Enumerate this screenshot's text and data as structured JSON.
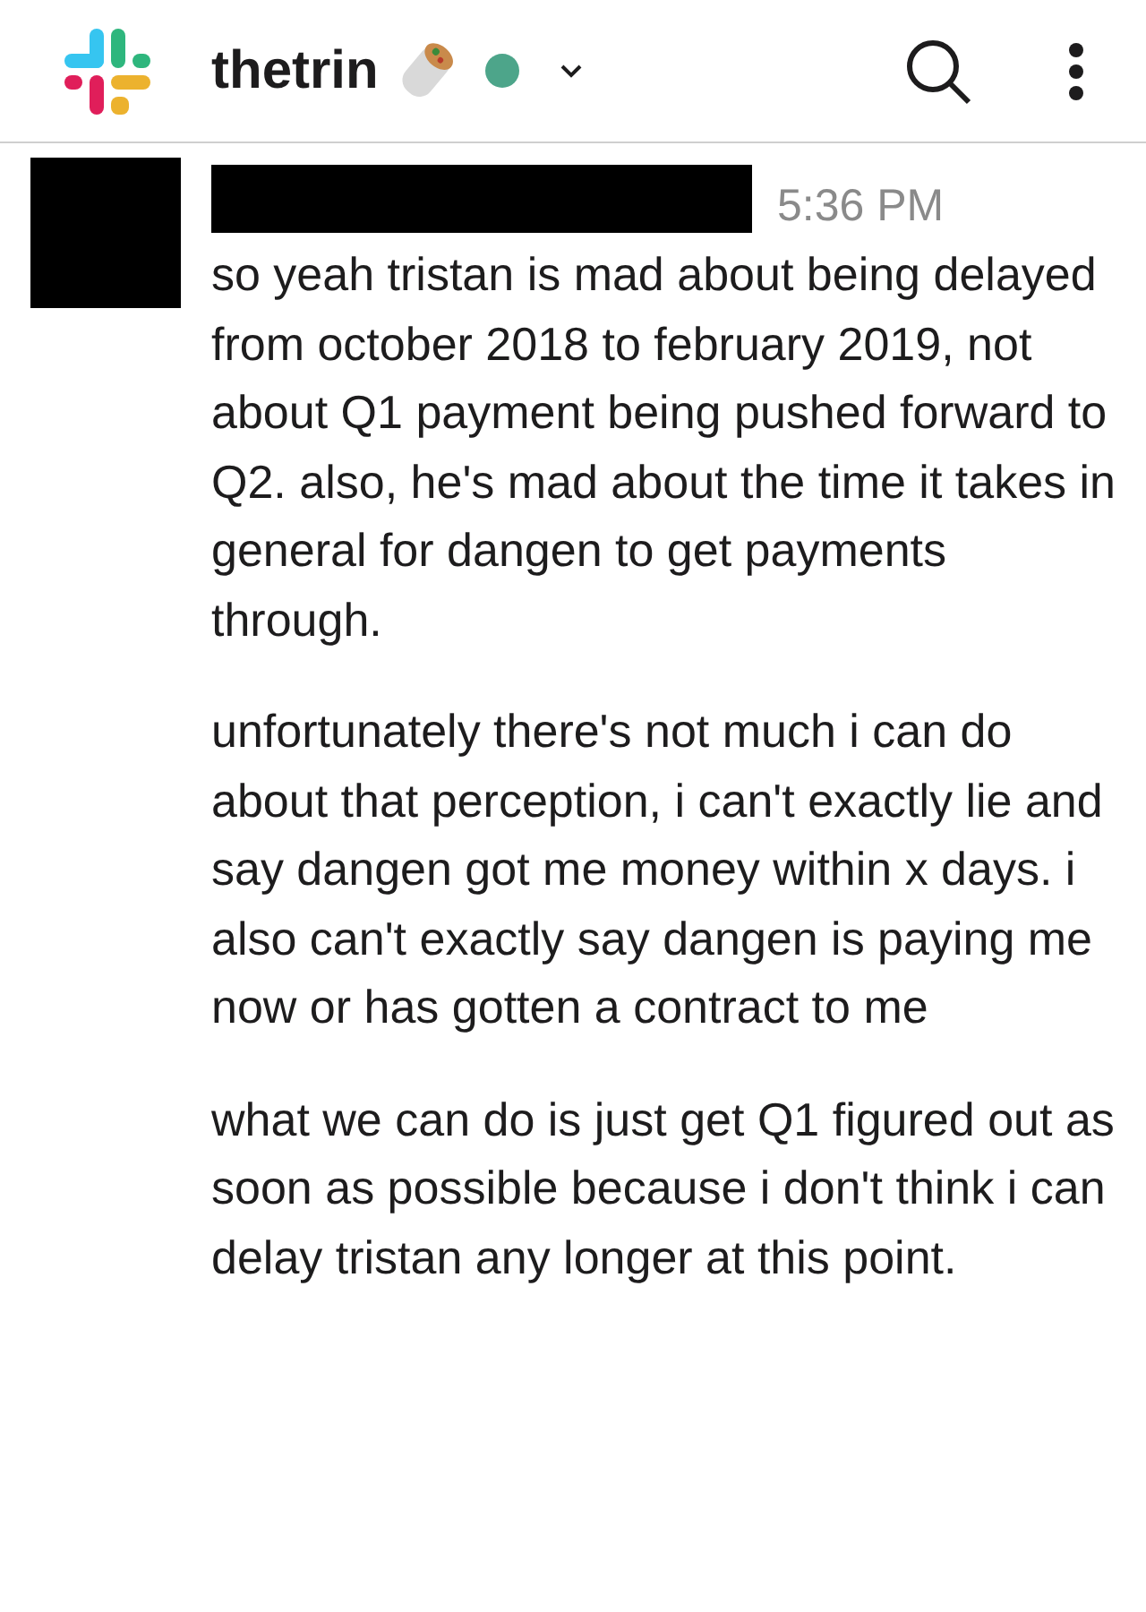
{
  "header": {
    "workspace": "thetrin",
    "online": true
  },
  "message": {
    "time": "5:36 PM",
    "paragraphs": [
      "so yeah tristan is mad about being delayed from october 2018 to february 2019, not about Q1 payment being pushed forward to Q2. also, he's mad about the time it takes in general for dangen to get payments through.",
      "unfortunately there's not much i can do about that perception, i can't exactly lie and say dangen got me money within x days. i also can't exactly say dangen is paying me now or has gotten a contract to me",
      "what we can do is just get Q1 figured out as soon as possible because i don't think i can delay tristan any longer at this point."
    ]
  }
}
